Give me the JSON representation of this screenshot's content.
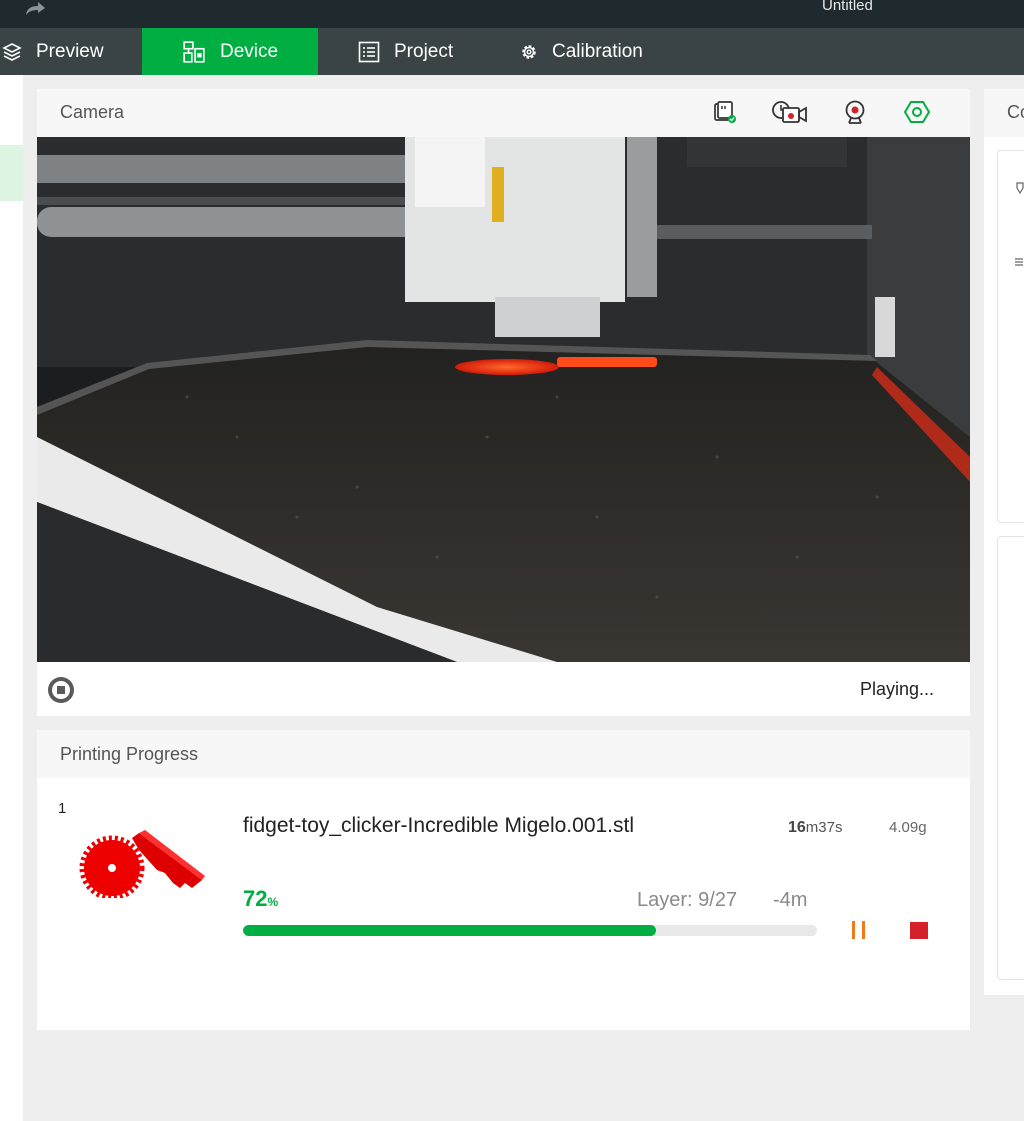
{
  "titlebar": {
    "title": "Untitled"
  },
  "tabs": [
    {
      "label": "Preview",
      "icon": "layers-icon"
    },
    {
      "label": "Device",
      "icon": "device-icon"
    },
    {
      "label": "Project",
      "icon": "list-icon"
    },
    {
      "label": "Calibration",
      "icon": "gear-icon"
    }
  ],
  "camera": {
    "label": "Camera",
    "status": "Playing...",
    "toolbar_icons": [
      "sd-card-icon",
      "timelapse-icon",
      "webcam-icon",
      "hexagon-settings-icon"
    ]
  },
  "progress": {
    "label": "Printing Progress",
    "plate_number": "1",
    "file_name": "fidget-toy_clicker-Incredible Migelo.001.stl",
    "duration_bold": "16",
    "duration_rest": "m37s",
    "weight": "4.09g",
    "percent_value": "72",
    "percent_unit": "%",
    "progress_fraction": 0.72,
    "layer": "Layer: 9/27",
    "remaining": "-4m"
  },
  "right_panel": {
    "label_fragment": "Co"
  },
  "colors": {
    "accent": "#00ae42",
    "pause": "#f07a1a",
    "stop": "#d4202a",
    "tabbar": "#3a4447",
    "titlebar": "#1f2a2e"
  }
}
